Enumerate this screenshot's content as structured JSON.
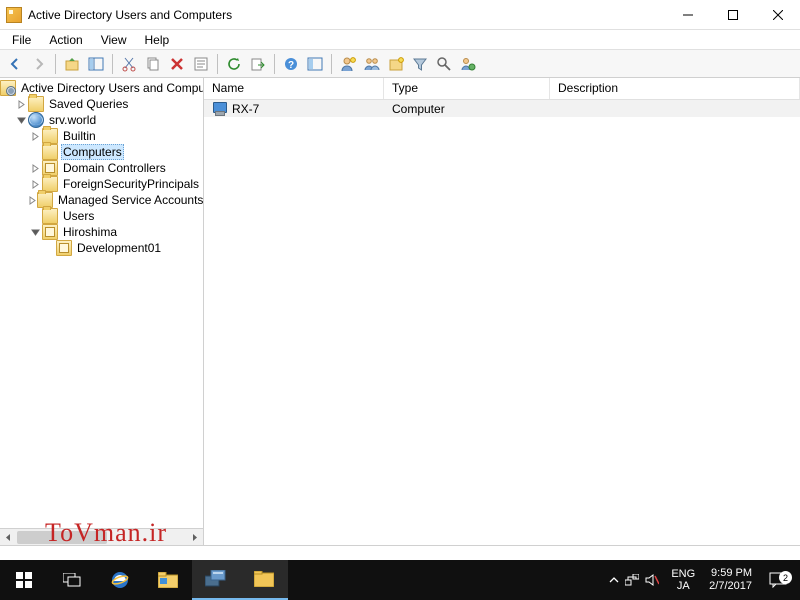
{
  "window": {
    "title": "Active Directory Users and Computers"
  },
  "menu": {
    "file": "File",
    "action": "Action",
    "view": "View",
    "help": "Help"
  },
  "tree": {
    "root": "Active Directory Users and Computers",
    "saved_queries": "Saved Queries",
    "domain": "srv.world",
    "builtin": "Builtin",
    "computers": "Computers",
    "domain_controllers": "Domain Controllers",
    "fsp": "ForeignSecurityPrincipals",
    "msa": "Managed Service Accounts",
    "users": "Users",
    "hiroshima": "Hiroshima",
    "dev01": "Development01"
  },
  "list": {
    "columns": {
      "name": "Name",
      "type": "Type",
      "desc": "Description"
    },
    "rows": [
      {
        "name": "RX-7",
        "type": "Computer",
        "desc": ""
      }
    ]
  },
  "watermark": "ToVman.ir",
  "taskbar": {
    "lang1": "ENG",
    "lang2": "JA",
    "time": "9:59 PM",
    "date": "2/7/2017",
    "notif_count": "2"
  }
}
